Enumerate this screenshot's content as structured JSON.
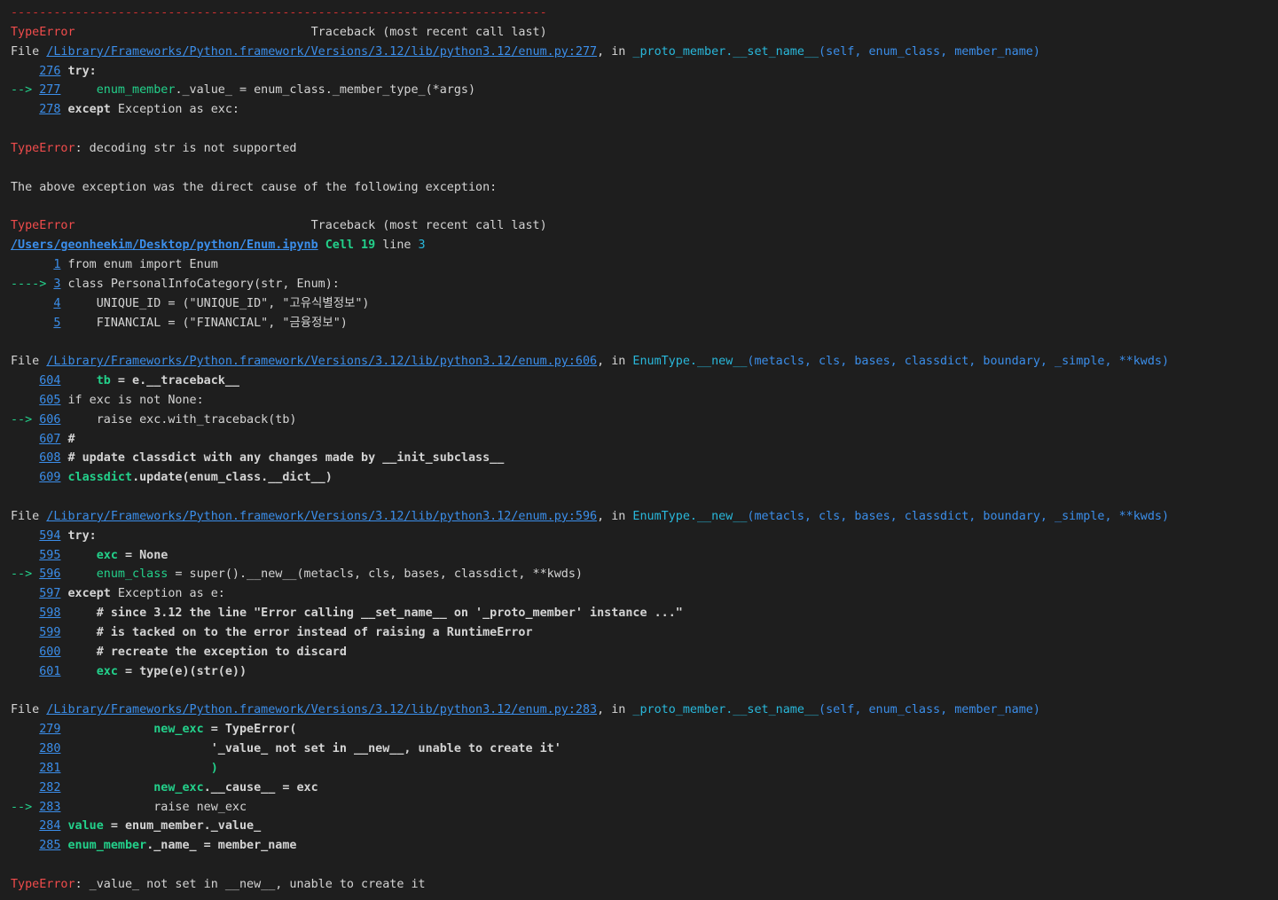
{
  "traceback": {
    "separator": "---------------------------------------------------------------------------",
    "header": {
      "error_type": "TypeError",
      "spacer": "                                 ",
      "title": "Traceback (most recent call last)"
    },
    "file_prefix": "File ",
    "in_word": ", in ",
    "frame1": {
      "path": "/Library/Frameworks/Python.framework/Versions/3.12/lib/python3.12/enum.py:277",
      "func_cls": "_proto_member",
      "func_name": ".__set_name__",
      "func_args": "(self, enum_class, member_name)",
      "lines": [
        {
          "arrow": "    ",
          "num": "276",
          "pre": " ",
          "code": "try:",
          "bold": true
        },
        {
          "arrow": "--> ",
          "num": "277",
          "pre": "     ",
          "green": "enum_member",
          "code": "._value_ = enum_class._member_type_(*args)",
          "bold": false
        },
        {
          "arrow": "    ",
          "num": "278",
          "pre": " ",
          "code": "except Exception as exc:",
          "bold_kw": "except",
          "rest": " Exception as exc:"
        }
      ]
    },
    "error1": {
      "type": "TypeError",
      "message": ": decoding str is not supported"
    },
    "cause_text": "The above exception was the direct cause of the following exception:",
    "header2": {
      "error_type": "TypeError",
      "spacer": "                                 ",
      "title": "Traceback (most recent call last)"
    },
    "cell": {
      "path": "/Users/geonheekim/Desktop/python/Enum.ipynb",
      "cell_label": " Cell ",
      "cell_num": "19",
      "line_label": " line ",
      "line_num": "3",
      "lines": [
        {
          "arrow": "      ",
          "num": "1",
          "code": " from enum import Enum"
        },
        {
          "arrow": "----> ",
          "num": "3",
          "code": " class PersonalInfoCategory(str, Enum):"
        },
        {
          "arrow": "      ",
          "num": "4",
          "code": "     UNIQUE_ID = (\"UNIQUE_ID\", \"고유식별정보\")"
        },
        {
          "arrow": "      ",
          "num": "5",
          "code": "     FINANCIAL = (\"FINANCIAL\", \"금융정보\")"
        }
      ]
    },
    "frame2": {
      "path": "/Library/Frameworks/Python.framework/Versions/3.12/lib/python3.12/enum.py:606",
      "func_cls": "EnumType",
      "func_name": ".__new__",
      "func_args": "(metacls, cls, bases, classdict, boundary, _simple, **kwds)",
      "l604_num": "604",
      "l604_green": "tb",
      "l604_rest": " = e.__traceback__",
      "l605_num": "605",
      "l605_code": " if exc is not None:",
      "l606_num": "606",
      "l606_code": "     raise exc.with_traceback(tb)",
      "l607_num": "607",
      "l607_code": " #",
      "l608_num": "608",
      "l608_code": " # update classdict with any changes made by __init_subclass__",
      "l609_num": "609",
      "l609_green": "classdict",
      "l609_rest": ".update(enum_class.__dict__)"
    },
    "frame3": {
      "path": "/Library/Frameworks/Python.framework/Versions/3.12/lib/python3.12/enum.py:596",
      "func_cls": "EnumType",
      "func_name": ".__new__",
      "func_args": "(metacls, cls, bases, classdict, boundary, _simple, **kwds)",
      "l594_num": "594",
      "l594_code": "try:",
      "l595_num": "595",
      "l595_green": "exc",
      "l595_rest": " = None",
      "l596_num": "596",
      "l596_green": "enum_class",
      "l596_rest": " = super().__new__(metacls, cls, bases, classdict, **kwds)",
      "l597_num": "597",
      "l597_kw": "except",
      "l597_rest": " Exception as e:",
      "l598_num": "598",
      "l598_code": "# since 3.12 the line \"Error calling __set_name__ on '_proto_member' instance ...\"",
      "l599_num": "599",
      "l599_code": "# is tacked on to the error instead of raising a RuntimeError",
      "l600_num": "600",
      "l600_code": "# recreate the exception to discard",
      "l601_num": "601",
      "l601_green": "exc",
      "l601_rest": " = type(e)(str(e))"
    },
    "frame4": {
      "path": "/Library/Frameworks/Python.framework/Versions/3.12/lib/python3.12/enum.py:283",
      "func_cls": "_proto_member",
      "func_name": ".__set_name__",
      "func_args": "(self, enum_class, member_name)",
      "l279_num": "279",
      "l279_green": "new_exc",
      "l279_rest": " = TypeError(",
      "l280_num": "280",
      "l280_code": "'_value_ not set in __new__, unable to create it'",
      "l281_num": "281",
      "l281_code": ")",
      "l282_num": "282",
      "l282_green": "new_exc",
      "l282_rest": ".__cause__ = exc",
      "l283_num": "283",
      "l283_code": "raise new_exc",
      "l284_num": "284",
      "l284_green": "value",
      "l284_rest": " = enum_member._value_",
      "l285_num": "285",
      "l285_green": "enum_member",
      "l285_rest": "._name_ = member_name"
    },
    "final_error": {
      "type": "TypeError",
      "message": ": _value_ not set in __new__, unable to create it"
    },
    "arrow_short": "--> ",
    "arrow_blank": "    "
  }
}
